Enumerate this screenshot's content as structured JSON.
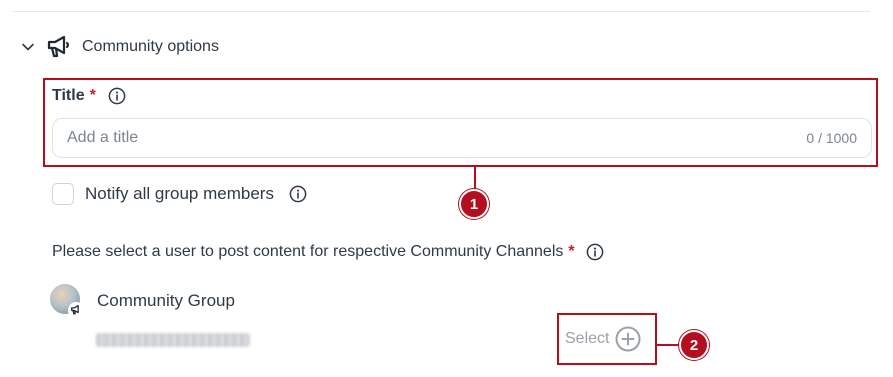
{
  "section": {
    "title": "Community options"
  },
  "title_field": {
    "label": "Title",
    "required_mark": "*",
    "placeholder": "Add a title",
    "value": "",
    "char_count": "0 / 1000"
  },
  "notify": {
    "label": "Notify all group members",
    "checked": false
  },
  "select_user": {
    "label": "Please select a user to post content for respective Community Channels",
    "required_mark": "*"
  },
  "group": {
    "name": "Community Group",
    "select_label": "Select"
  },
  "callouts": {
    "first": "1",
    "second": "2"
  },
  "colors": {
    "accent_red": "#b30f1e",
    "text": "#2f3a45",
    "muted": "#7a8591"
  },
  "icons": [
    "chevron-down-icon",
    "megaphone-icon",
    "info-icon",
    "plus-circle-icon"
  ]
}
